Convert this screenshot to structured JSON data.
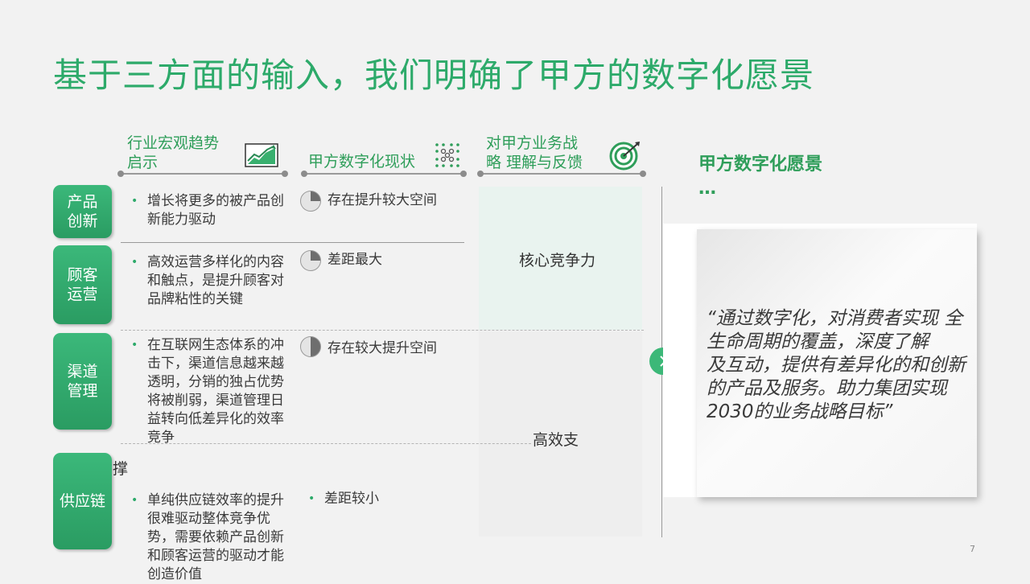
{
  "title": "基于三方面的输入，我们明确了甲方的数字化愿景",
  "columns": {
    "trends": {
      "line1": "行业宏观趋势",
      "line2": "启示",
      "icon": "trend-chart-icon"
    },
    "status": {
      "label": "甲方数字化现状",
      "icon": "network-dots-icon"
    },
    "feedback": {
      "line1": "对甲方业务战",
      "line2": "略 理解与反馈",
      "icon": "target-icon"
    }
  },
  "vision": {
    "heading": "甲方数字化愿景",
    "ellipsis": "…"
  },
  "rows": [
    {
      "tag_line1": "产品",
      "tag_line2": "创新",
      "trend": "增长将更多的被产品创新能力驱动",
      "status": "存在提升较大空间",
      "pie_fraction": 0.25
    },
    {
      "tag_line1": "顾客",
      "tag_line2": "运营",
      "trend": "高效运营多样化的内容和触点，是提升顾客对品牌粘性的关键",
      "status": "差距最大",
      "pie_fraction": 0.25
    },
    {
      "tag_line1": "渠道",
      "tag_line2": "管理",
      "trend": "在互联网生态体系的冲击下，渠道信息越来越透明，分销的独占优势将被削弱，渠道管理日益转向低差异化的效率竞争",
      "status": "存在较大提升空间",
      "pie_fraction": 0.5
    },
    {
      "tag_line1": "供应链",
      "tag_line2": "",
      "trend": "单纯供应链效率的提升很难驱动整体竞争优势，需要依赖产品创新和顾客运营的驱动才能创造价值",
      "status": "差距较小"
    }
  ],
  "feedback_labels": {
    "core": "核心竞争力",
    "support_part1": "高效支",
    "support_part2": "撑"
  },
  "quote": "“通过数字化，对消费者实现 全生命周期的覆盖，深度了解\n及互动，提供有差异化的和创新的产品及服务。助力集团实现2030的业务战略目标”",
  "page_number": "7",
  "colors": {
    "accent": "#2daa6a",
    "tag": "#2f9e5a",
    "pie_dark": "#6e6e6e",
    "pie_light": "#e4e4e4"
  }
}
